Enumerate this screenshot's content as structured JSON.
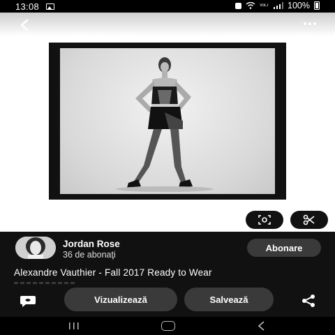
{
  "status_bar": {
    "time": "13:08",
    "battery": "100%",
    "network": "VoLTE"
  },
  "viewer": {
    "icons": [
      "back-icon",
      "more-icon",
      "lens-icon",
      "scissors-icon"
    ],
    "image_description_colors": {
      "frame": "#111111",
      "background": "#ffffff"
    }
  },
  "author": {
    "name": "Jordan Rose",
    "followers": "36 de abonaţi",
    "follow_label": "Abonare"
  },
  "pin": {
    "title": "Alexandre Vauthier - Fall 2017 Ready to Wear"
  },
  "actions": {
    "view_label": "Vizualizează",
    "save_label": "Salvează"
  }
}
